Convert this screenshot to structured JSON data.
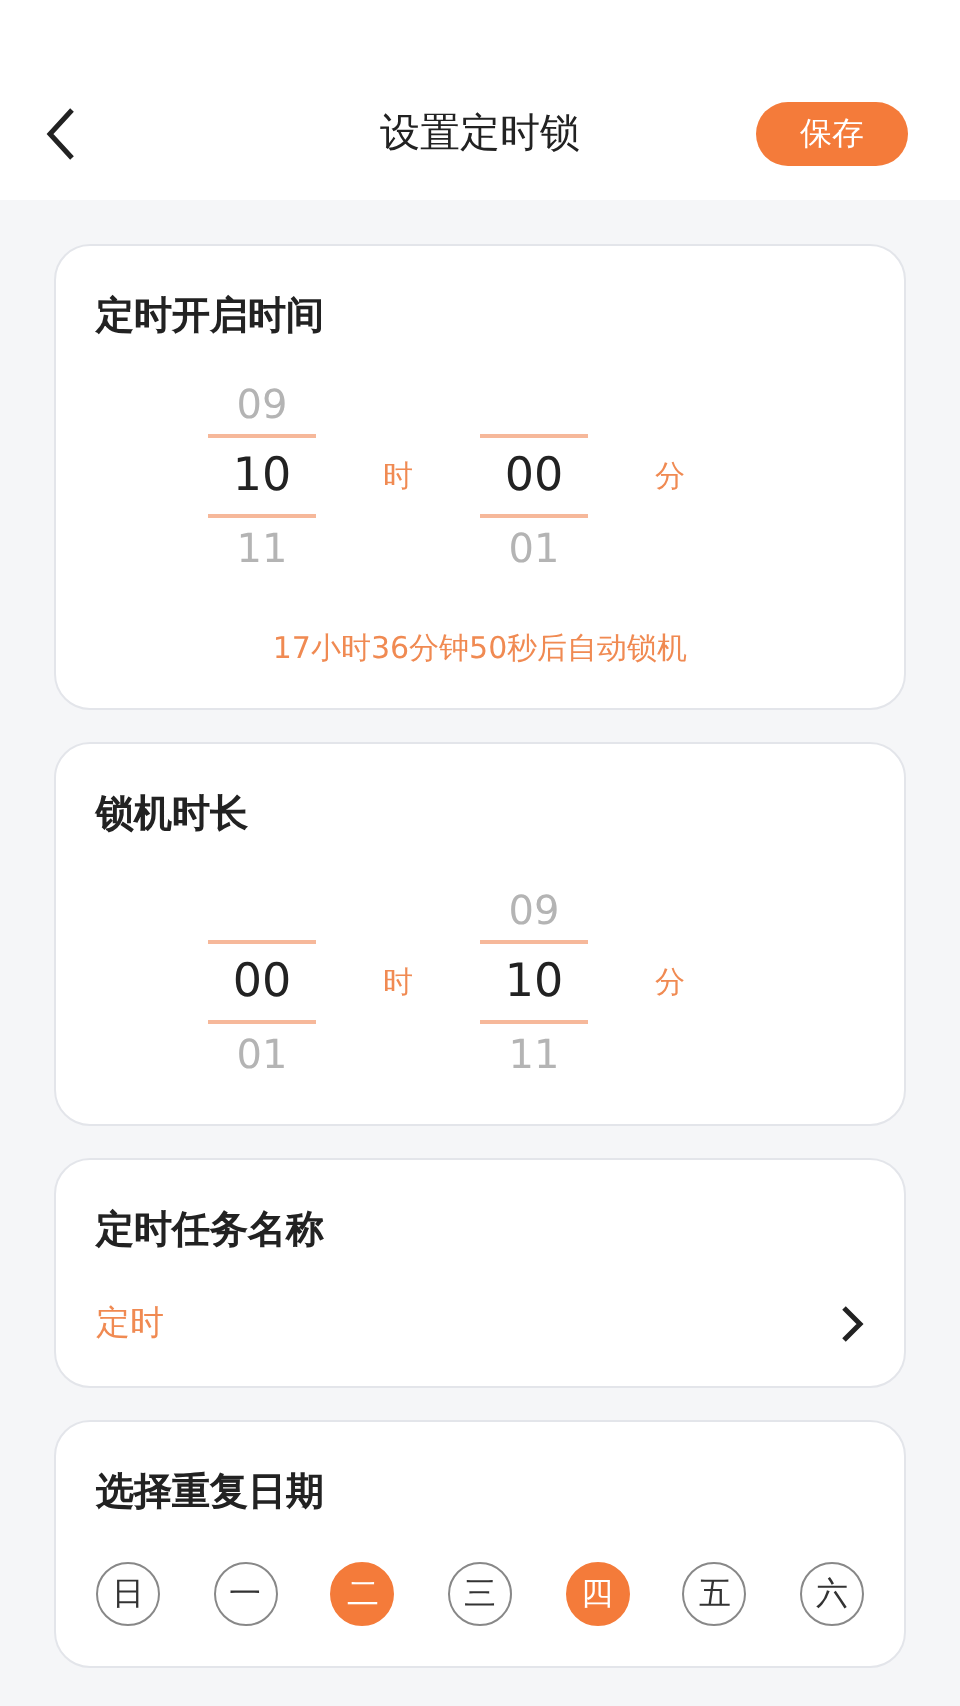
{
  "header": {
    "title": "设置定时锁",
    "save_button": "保存"
  },
  "start_time": {
    "title": "定时开启时间",
    "pickers": [
      {
        "prev": "09",
        "value": "10",
        "next": "11",
        "unit": "时"
      },
      {
        "value": "00",
        "next": "01",
        "unit": "分"
      }
    ],
    "note": "17小时36分钟50秒后自动锁机"
  },
  "duration": {
    "title": "锁机时长",
    "pickers": [
      {
        "value": "00",
        "next": "01",
        "unit": "时"
      },
      {
        "prev": "09",
        "value": "10",
        "next": "11",
        "unit": "分"
      }
    ]
  },
  "task_name": {
    "title": "定时任务名称",
    "value": "定时"
  },
  "repeat_days": {
    "title": "选择重复日期",
    "days": [
      {
        "label": "日",
        "selected": false
      },
      {
        "label": "一",
        "selected": false
      },
      {
        "label": "二",
        "selected": true
      },
      {
        "label": "三",
        "selected": false
      },
      {
        "label": "四",
        "selected": true
      },
      {
        "label": "五",
        "selected": false
      },
      {
        "label": "六",
        "selected": false
      }
    ]
  }
}
